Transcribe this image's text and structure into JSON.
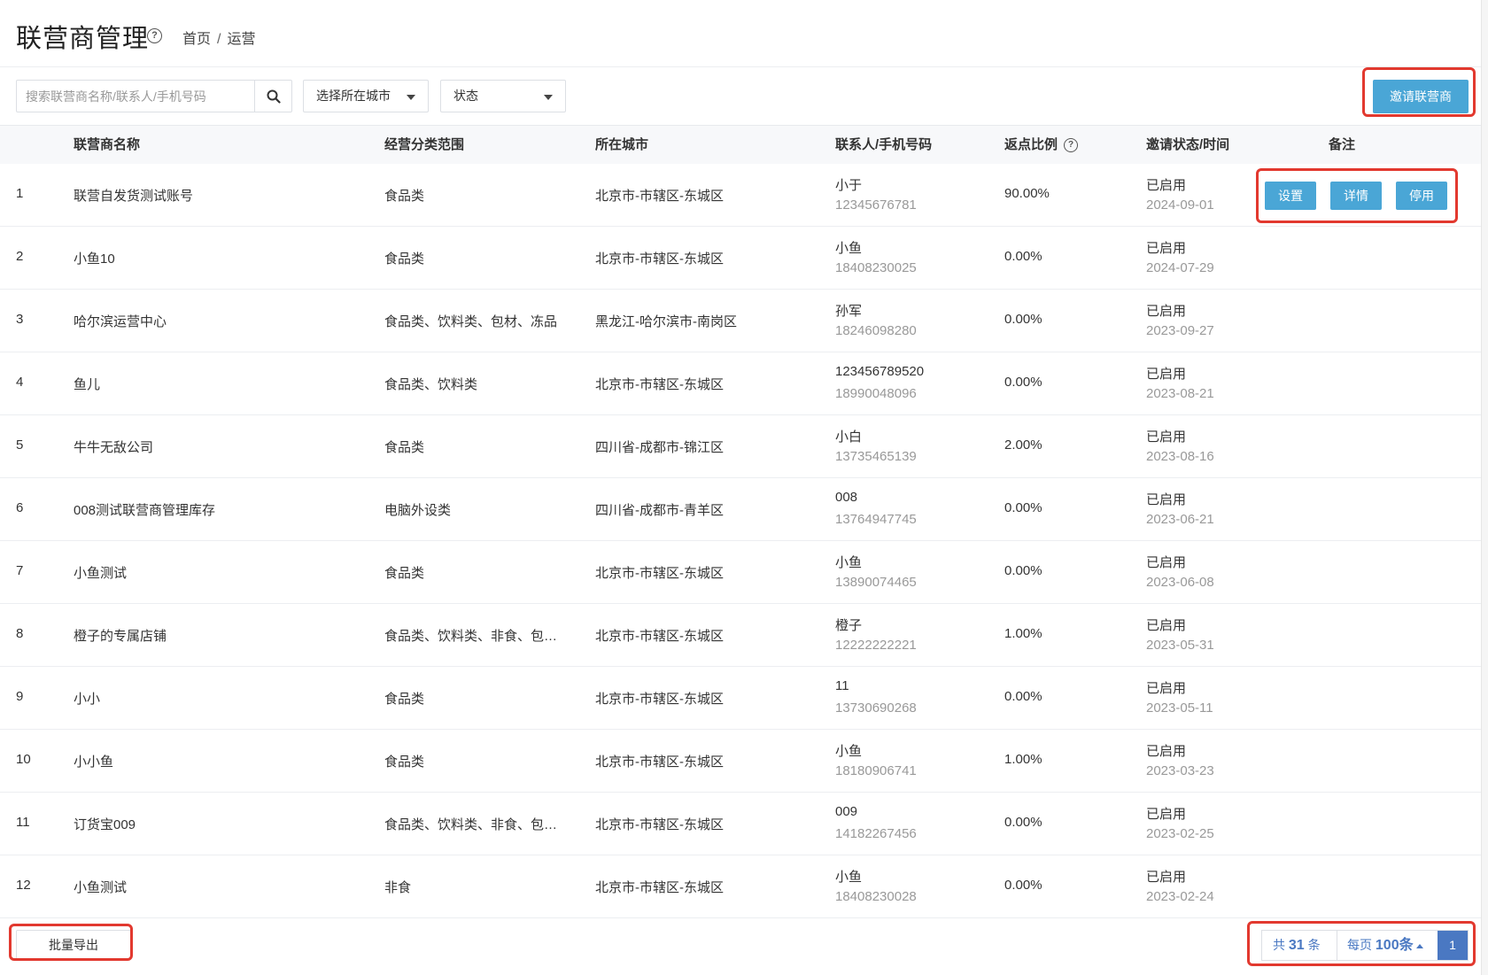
{
  "header": {
    "title": "联营商管理",
    "breadcrumb": [
      "首页",
      "运营"
    ],
    "help_icon": "question-circle-icon"
  },
  "toolbar": {
    "search_placeholder": "搜索联营商名称/联系人/手机号码",
    "search_value": "",
    "search_icon": "search-icon",
    "city_select": "选择所在城市",
    "status_select": "状态",
    "invite_button": "邀请联营商"
  },
  "table": {
    "columns": [
      "联营商名称",
      "经营分类范围",
      "所在城市",
      "联系人/手机号码",
      "返点比例",
      "邀请状态/时间",
      "备注"
    ],
    "row_actions": [
      "设置",
      "详情",
      "停用"
    ],
    "rows": [
      {
        "index": "1",
        "name": "联营自发货测试账号",
        "category": "食品类",
        "city": "北京市-市辖区-东城区",
        "contact": "小于",
        "phone": "12345676781",
        "rebate": "90.00%",
        "status": "已启用",
        "date": "2024-09-01"
      },
      {
        "index": "2",
        "name": "小鱼10",
        "category": "食品类",
        "city": "北京市-市辖区-东城区",
        "contact": "小鱼",
        "phone": "18408230025",
        "rebate": "0.00%",
        "status": "已启用",
        "date": "2024-07-29"
      },
      {
        "index": "3",
        "name": "哈尔滨运营中心",
        "category": "食品类、饮料类、包材、冻品",
        "city": "黑龙江-哈尔滨市-南岗区",
        "contact": "孙军",
        "phone": "18246098280",
        "rebate": "0.00%",
        "status": "已启用",
        "date": "2023-09-27"
      },
      {
        "index": "4",
        "name": "鱼儿",
        "category": "食品类、饮料类",
        "city": "北京市-市辖区-东城区",
        "contact": "123456789520",
        "phone": "18990048096",
        "rebate": "0.00%",
        "status": "已启用",
        "date": "2023-08-21"
      },
      {
        "index": "5",
        "name": "牛牛无敌公司",
        "category": "食品类",
        "city": "四川省-成都市-锦江区",
        "contact": "小白",
        "phone": "13735465139",
        "rebate": "2.00%",
        "status": "已启用",
        "date": "2023-08-16"
      },
      {
        "index": "6",
        "name": "008测试联营商管理库存",
        "category": "电脑外设类",
        "city": "四川省-成都市-青羊区",
        "contact": "008",
        "phone": "13764947745",
        "rebate": "0.00%",
        "status": "已启用",
        "date": "2023-06-21"
      },
      {
        "index": "7",
        "name": "小鱼测试",
        "category": "食品类",
        "city": "北京市-市辖区-东城区",
        "contact": "小鱼",
        "phone": "13890074465",
        "rebate": "0.00%",
        "status": "已启用",
        "date": "2023-06-08"
      },
      {
        "index": "8",
        "name": "橙子的专属店铺",
        "category": "食品类、饮料类、非食、包…",
        "city": "北京市-市辖区-东城区",
        "contact": "橙子",
        "phone": "12222222221",
        "rebate": "1.00%",
        "status": "已启用",
        "date": "2023-05-31"
      },
      {
        "index": "9",
        "name": "小小",
        "category": "食品类",
        "city": "北京市-市辖区-东城区",
        "contact": "11",
        "phone": "13730690268",
        "rebate": "0.00%",
        "status": "已启用",
        "date": "2023-05-11"
      },
      {
        "index": "10",
        "name": "小小鱼",
        "category": "食品类",
        "city": "北京市-市辖区-东城区",
        "contact": "小鱼",
        "phone": "18180906741",
        "rebate": "1.00%",
        "status": "已启用",
        "date": "2023-03-23"
      },
      {
        "index": "11",
        "name": "订货宝009",
        "category": "食品类、饮料类、非食、包…",
        "city": "北京市-市辖区-东城区",
        "contact": "009",
        "phone": "14182267456",
        "rebate": "0.00%",
        "status": "已启用",
        "date": "2023-02-25"
      },
      {
        "index": "12",
        "name": "小鱼测试",
        "category": "非食",
        "city": "北京市-市辖区-东城区",
        "contact": "小鱼",
        "phone": "18408230028",
        "rebate": "0.00%",
        "status": "已启用",
        "date": "2023-02-24"
      }
    ]
  },
  "footer": {
    "export_button": "批量导出",
    "total_prefix": "共",
    "total_count": "31",
    "total_suffix": "条",
    "per_page_prefix": "每页",
    "per_page_value": "100条",
    "current_page": "1"
  },
  "colors": {
    "primary_button": "#4aa6d6",
    "pager_accent": "#4a78c2",
    "highlight_box": "#e2392f"
  }
}
